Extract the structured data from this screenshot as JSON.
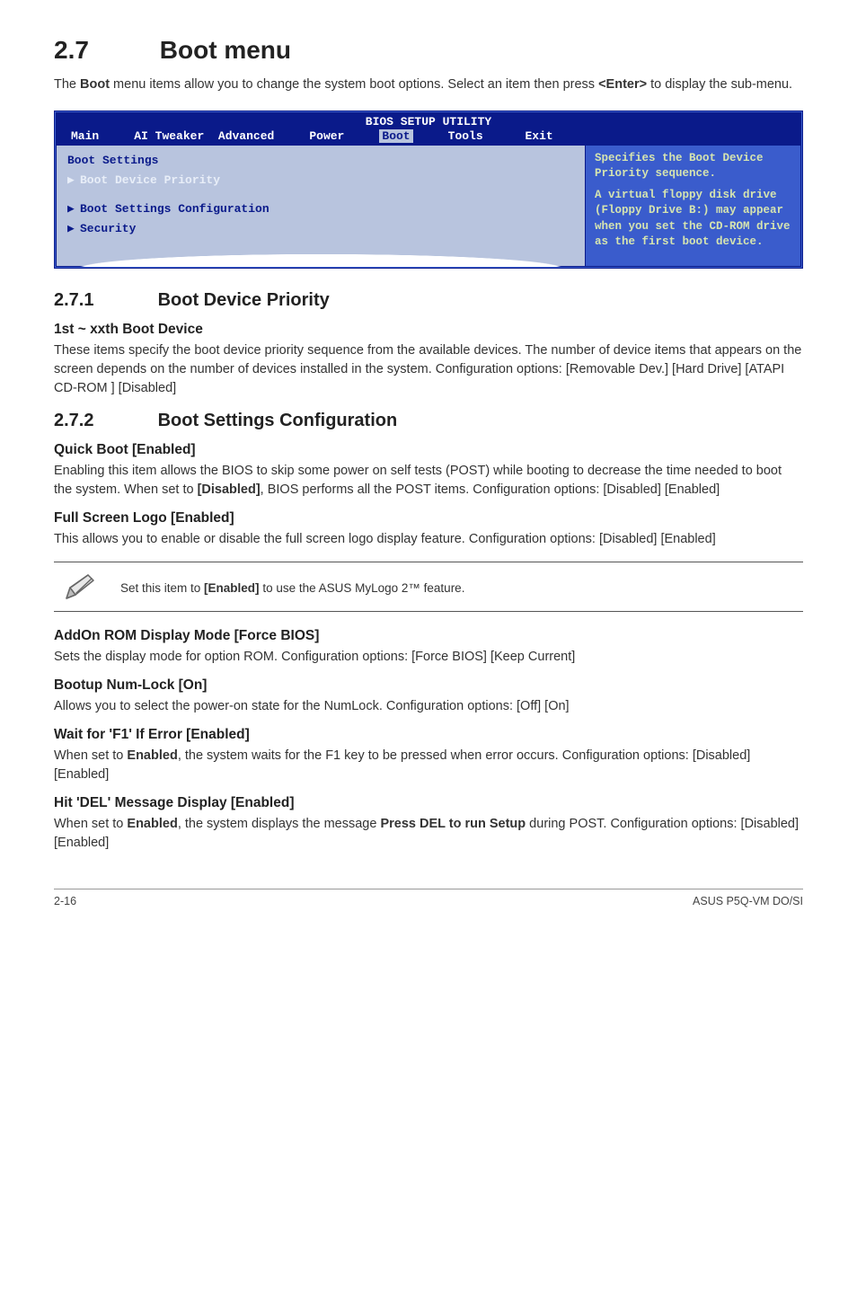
{
  "section": {
    "number": "2.7",
    "title": "Boot menu",
    "intro_pre": "The ",
    "intro_bold1": "Boot",
    "intro_mid": " menu items allow you to change the system boot options. Select an item then press ",
    "intro_bold2": "<Enter>",
    "intro_post": " to display the sub-menu."
  },
  "bios": {
    "header": "BIOS SETUP UTILITY",
    "tabs": {
      "main": "Main",
      "ai": "AI Tweaker",
      "advanced": "Advanced",
      "power": "Power",
      "boot": "Boot",
      "tools": "Tools",
      "exit": "Exit"
    },
    "left": {
      "title": "Boot Settings",
      "item1": "Boot Device Priority",
      "item2": "Boot Settings Configuration",
      "item3": "Security"
    },
    "right": {
      "line1": "Specifies the Boot Device Priority sequence.",
      "line2": "A virtual floppy disk drive (Floppy Drive B:) may appear when you set the CD-ROM drive as the first boot device."
    }
  },
  "s271": {
    "num": "2.7.1",
    "title": "Boot Device Priority",
    "h1": "1st ~ xxth Boot Device",
    "p1": "These items specify the boot device priority sequence from the available devices. The number of device items that appears on the screen depends on the number of devices installed in the system. Configuration options: [Removable Dev.] [Hard Drive] [ATAPI CD-ROM ] [Disabled]"
  },
  "s272": {
    "num": "2.7.2",
    "title": "Boot Settings Configuration",
    "quick_h": "Quick Boot [Enabled]",
    "quick_p_pre": "Enabling this item allows the BIOS to skip some power on self tests (POST) while booting to decrease the time needed to boot the system. When set to ",
    "quick_p_bold": "[Disabled]",
    "quick_p_post": ", BIOS performs all the POST items. Configuration options: [Disabled] [Enabled]",
    "logo_h": "Full Screen Logo [Enabled]",
    "logo_p": "This allows you to enable or disable the full screen logo display feature. Configuration options: [Disabled] [Enabled]",
    "note_pre": "Set this item to ",
    "note_bold": "[Enabled]",
    "note_post": " to use the ASUS MyLogo 2™ feature.",
    "addon_h": "AddOn ROM Display Mode [Force BIOS]",
    "addon_p": "Sets the display mode for option ROM. Configuration options: [Force BIOS] [Keep Current]",
    "numlock_h": "Bootup Num-Lock [On]",
    "numlock_p": "Allows you to select the power-on state for the NumLock. Configuration options: [Off] [On]",
    "f1_h": "Wait for 'F1' If Error [Enabled]",
    "f1_p_pre": "When set to ",
    "f1_p_bold": "Enabled",
    "f1_p_post": ", the system waits for the F1 key to be pressed when error occurs. Configuration options: [Disabled] [Enabled]",
    "del_h": "Hit 'DEL' Message Display [Enabled]",
    "del_p_pre": "When set to ",
    "del_p_bold1": "Enabled",
    "del_p_mid": ", the system displays the message ",
    "del_p_bold2": "Press DEL to run Setup",
    "del_p_post": " during POST. Configuration options: [Disabled] [Enabled]"
  },
  "footer": {
    "left": "2-16",
    "right": "ASUS P5Q-VM DO/SI"
  }
}
